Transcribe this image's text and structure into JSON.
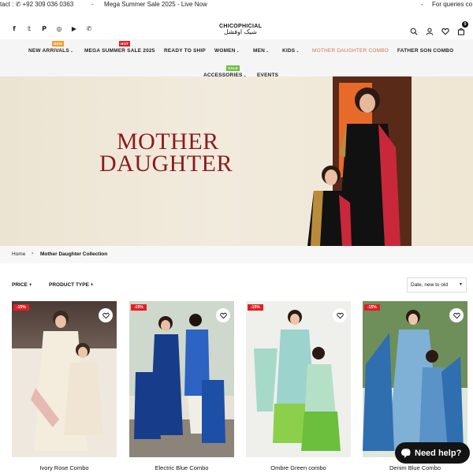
{
  "announcement": {
    "contact": "tact : ✆ +92 309 036 0363",
    "dash1": "-",
    "sale": "Mega Summer Sale 2025 - Live Now",
    "dash2": "-",
    "queries": "For queries co"
  },
  "header": {
    "logo_en": "CHICOPHICIAL",
    "logo_ur": "شیک اوفشل",
    "cart_count": "0",
    "icons": [
      "facebook-icon",
      "twitter-icon",
      "pinterest-icon",
      "instagram-icon",
      "youtube-icon",
      "whatsapp-icon",
      "search-icon",
      "user-icon",
      "heart-icon",
      "cart-icon"
    ]
  },
  "nav": {
    "new_arrivals": "NEW ARRIVALS",
    "new_badge": "NEW",
    "mega_sale": "MEGA SUMMER SALE 2025",
    "hot_badge": "HOT",
    "ready": "READY TO SHIP",
    "women": "WOMEN",
    "men": "MEN",
    "kids": "KIDS",
    "mother_daughter": "MOTHER DAUGHTER COMBO",
    "father_son": "FATHER SON COMBO",
    "accessories": "ACCESSORIES",
    "sale_badge": "SALE",
    "events": "EVENTS"
  },
  "hero": {
    "line1": "MOTHER",
    "line2": "DAUGHTER"
  },
  "breadcrumb": {
    "home": "Home",
    "current": "Mother Daughter Collection"
  },
  "filters": {
    "price": "PRICE",
    "product_type": "PRODUCT TYPE",
    "sort": "Date, new to old"
  },
  "products": [
    {
      "title": "Ivory Rose Combo",
      "discount": "-15%"
    },
    {
      "title": "Electric Blue Combo",
      "discount": "-15%"
    },
    {
      "title": "Ombre Green combo",
      "discount": "-15%"
    },
    {
      "title": "Denim Blue Combo",
      "discount": "-15%"
    }
  ],
  "help": {
    "label": "Need help?"
  },
  "colors": {
    "accent": "#c97a4a",
    "hero_text": "#8b1a1f",
    "discount": "#e31e24"
  }
}
